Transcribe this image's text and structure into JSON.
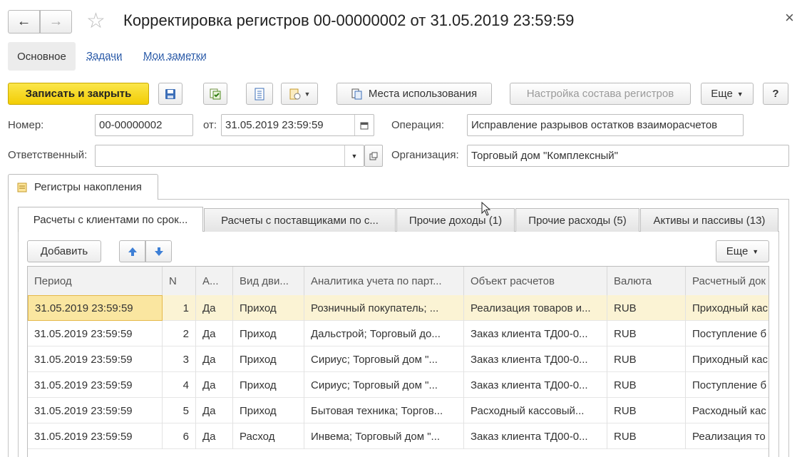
{
  "window": {
    "title": "Корректировка регистров 00-00000002 от 31.05.2019 23:59:59"
  },
  "nav": {
    "back": "←",
    "forward": "→",
    "star": "☆",
    "close": "×"
  },
  "section_tabs": [
    {
      "label": "Основное",
      "active": true
    },
    {
      "label": "Задачи",
      "active": false
    },
    {
      "label": "Мои заметки",
      "active": false
    }
  ],
  "toolbar": {
    "save_close": "Записать и закрыть",
    "usage_places": "Места использования",
    "registers_setup": "Настройка состава регистров",
    "more": "Еще",
    "help": "?"
  },
  "form": {
    "number_label": "Номер:",
    "number_value": "00-00000002",
    "date_label": "от:",
    "date_value": "31.05.2019 23:59:59",
    "operation_label": "Операция:",
    "operation_value": "Исправление разрывов остатков взаиморасчетов",
    "responsible_label": "Ответственный:",
    "responsible_value": "",
    "org_label": "Организация:",
    "org_value": "Торговый дом \"Комплексный\""
  },
  "outer_tab": {
    "label": "Регистры накопления"
  },
  "register_tabs": [
    {
      "label": "Расчеты с клиентами по срок...",
      "active": true
    },
    {
      "label": "Расчеты с поставщиками по с...",
      "active": false
    },
    {
      "label": "Прочие доходы (1)",
      "active": false
    },
    {
      "label": "Прочие расходы (5)",
      "active": false
    },
    {
      "label": "Активы и пассивы (13)",
      "active": false
    }
  ],
  "table_toolbar": {
    "add": "Добавить",
    "more": "Еще"
  },
  "table": {
    "columns": [
      "Период",
      "N",
      "А...",
      "Вид дви...",
      "Аналитика учета по парт...",
      "Объект расчетов",
      "Валюта",
      "Расчетный док"
    ],
    "rows": [
      [
        "31.05.2019 23:59:59",
        "1",
        "Да",
        "Приход",
        "Розничный покупатель; ...",
        "Реализация товаров и...",
        "RUB",
        "Приходный кас"
      ],
      [
        "31.05.2019 23:59:59",
        "2",
        "Да",
        "Приход",
        "Дальстрой; Торговый до...",
        "Заказ клиента ТД00-0...",
        "RUB",
        "Поступление б"
      ],
      [
        "31.05.2019 23:59:59",
        "3",
        "Да",
        "Приход",
        "Сириус; Торговый дом \"...",
        "Заказ клиента ТД00-0...",
        "RUB",
        "Приходный кас"
      ],
      [
        "31.05.2019 23:59:59",
        "4",
        "Да",
        "Приход",
        "Сириус; Торговый дом \"...",
        "Заказ клиента ТД00-0...",
        "RUB",
        "Поступление б"
      ],
      [
        "31.05.2019 23:59:59",
        "5",
        "Да",
        "Приход",
        "Бытовая техника; Торгов...",
        "Расходный кассовый...",
        "RUB",
        "Расходный кас"
      ],
      [
        "31.05.2019 23:59:59",
        "6",
        "Да",
        "Расход",
        "Инвема; Торговый дом \"...",
        "Заказ клиента ТД00-0...",
        "RUB",
        "Реализация то"
      ]
    ],
    "selected_row": 0
  },
  "colors": {
    "primary_button": "#f2cd05",
    "selected_row": "#fbf3d4",
    "link": "#2a5aa8"
  }
}
